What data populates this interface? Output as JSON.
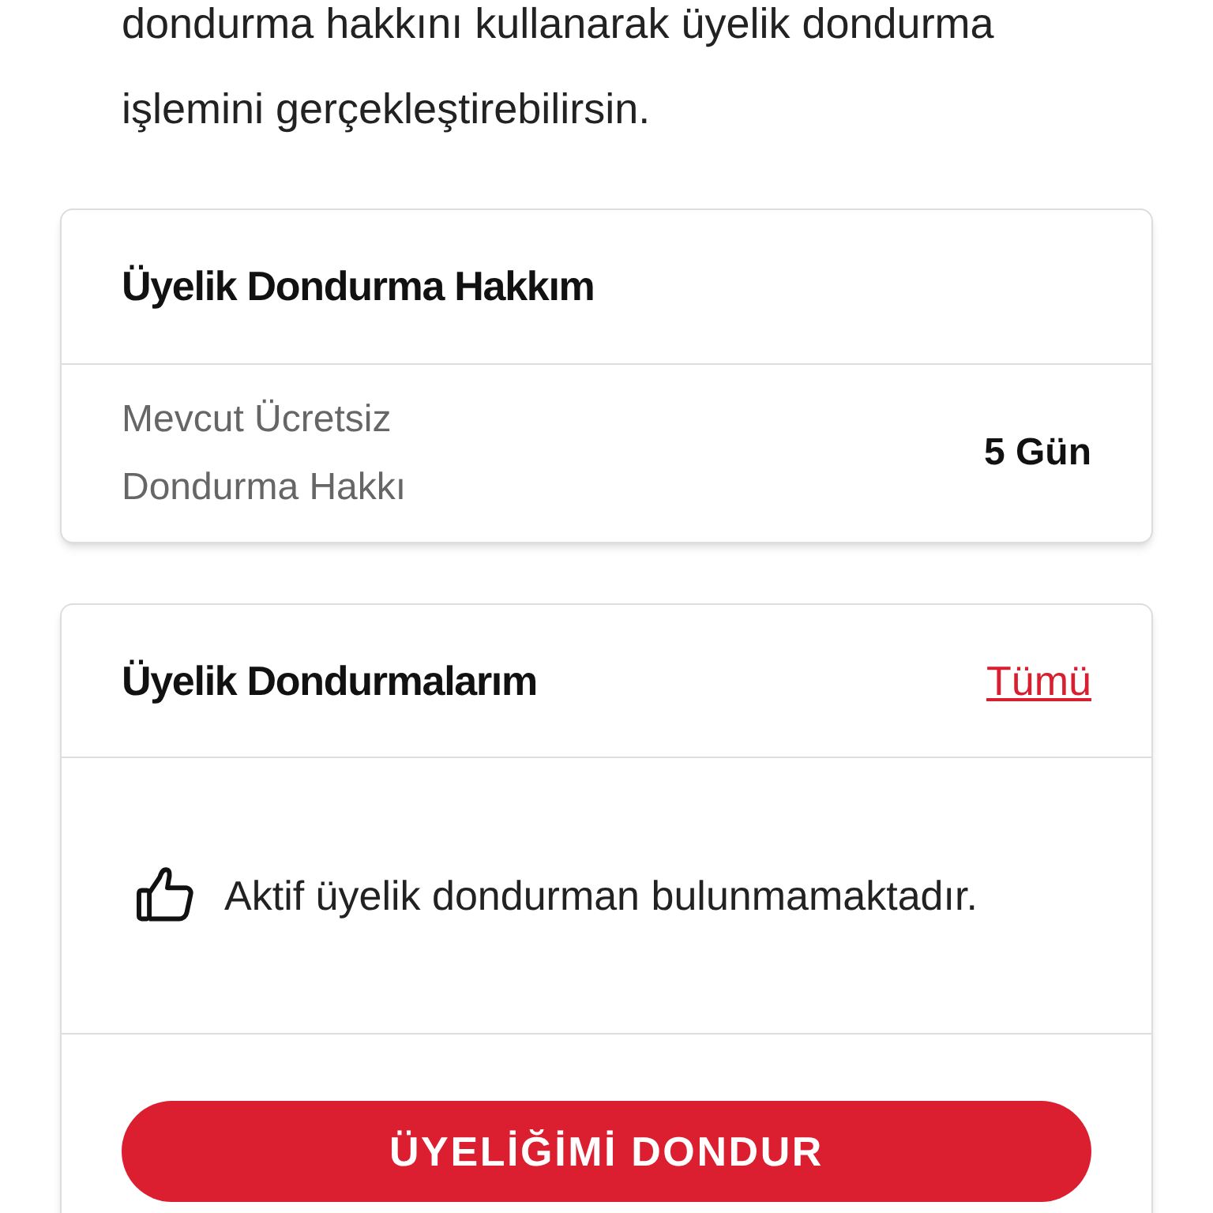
{
  "intro": "dondurma hakkını kullanarak üyelik dondurma işlemini gerçekleştirebilirsin.",
  "allowance_card": {
    "title": "Üyelik Dondurma Hakkım",
    "label": "Mevcut Ücretsiz Dondurma Hakkı",
    "value": "5 Gün"
  },
  "freezes_card": {
    "title": "Üyelik Dondurmalarım",
    "link": "Tümü",
    "empty_message": "Aktif üyelik dondurman bulunmamaktadır.",
    "button": "ÜYELİĞİMİ DONDUR"
  }
}
